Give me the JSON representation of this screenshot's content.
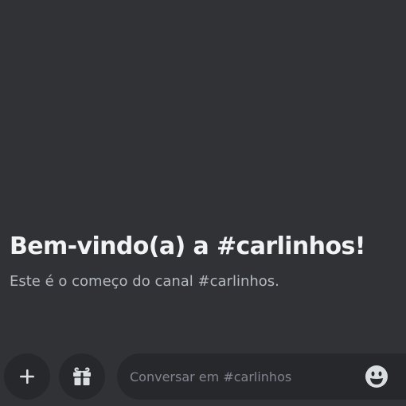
{
  "channel": {
    "welcome_title": "Bem-vindo(a) a #carlinhos!",
    "welcome_subtitle": "Este é o começo do canal #carlinhos."
  },
  "composer": {
    "placeholder": "Conversar em #carlinhos",
    "buttons": {
      "add_icon": "plus-icon",
      "gift_icon": "gift-icon",
      "emoji_icon": "emoji-icon"
    }
  },
  "colors": {
    "background": "#303236",
    "input_background": "#26282c",
    "title_text": "#f2f3f5",
    "subtitle_text": "#b5bac1",
    "placeholder_text": "#80848e",
    "icon": "#dbdee1"
  }
}
